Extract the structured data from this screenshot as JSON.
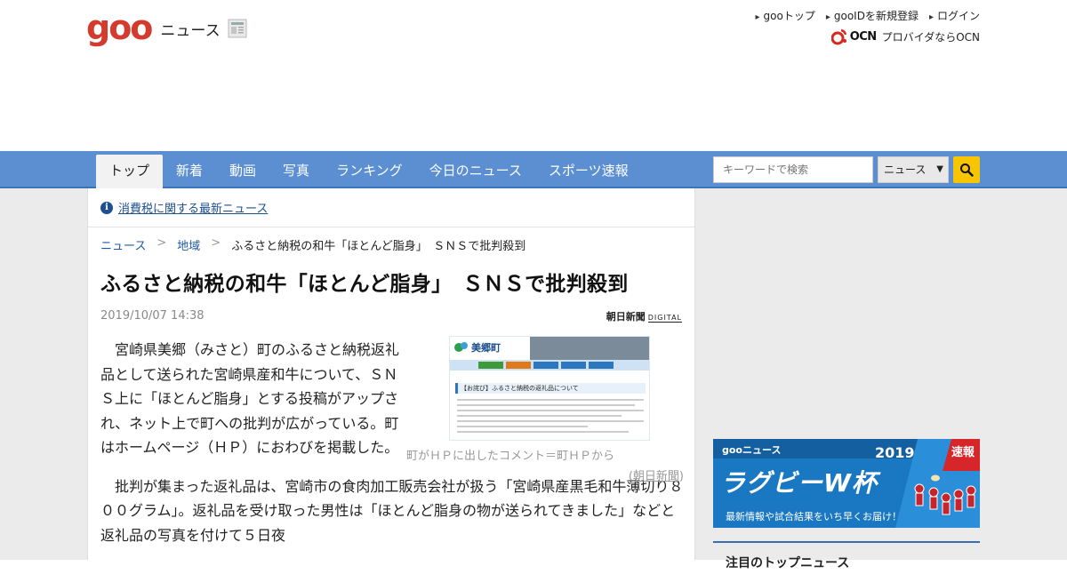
{
  "header": {
    "logo_text": "goo",
    "logo_subtitle": "ニュース",
    "links": [
      "gooトップ",
      "gooIDを新規登録",
      "ログイン"
    ],
    "ocn_label": "プロバイダならOCN",
    "ocn_logo": "OCN"
  },
  "nav": {
    "tabs": [
      "トップ",
      "新着",
      "動画",
      "写真",
      "ランキング",
      "今日のニュース",
      "スポーツ速報"
    ],
    "active_tab": "トップ",
    "search_placeholder": "キーワードで検索",
    "search_scope": "ニュース"
  },
  "notice": {
    "text": "消費税に関する最新ニュース"
  },
  "breadcrumb": {
    "items": [
      "ニュース",
      "地域",
      "ふるさと納税の和牛「ほとんど脂身」　ＳＮＳで批判殺到"
    ]
  },
  "article": {
    "title": "ふるさと納税の和牛「ほとんど脂身」　ＳＮＳで批判殺到",
    "date": "2019/10/07 14:38",
    "source_logo": "朝日新聞",
    "source_logo_suffix": "DIGITAL",
    "paragraphs": [
      "　宮崎県美郷（みさと）町のふるさと納税返礼品として送られた宮崎県産和牛について、ＳＮＳ上に「ほとんど脂身」とする投稿がアップされ、ネット上で町への批判が広がっている。町はホームページ（ＨＰ）におわびを掲載した。",
      "　批判が集まった返礼品は、宮崎市の食肉加工販売会社が扱う「宮崎県産黒毛和牛薄切り８００グラム」。返礼品を受け取った男性は「ほとんど脂身の物が送られてきました」などと返礼品の写真を付けて５日夜"
    ],
    "photo": {
      "caption": "町がＨＰに出したコメント＝町ＨＰから",
      "credit": "朝日新聞",
      "site_name": "美郷町",
      "headline": "【お詫び】ふるさと納税の返礼品について"
    }
  },
  "sidebar": {
    "banner_brand": "gooニュース",
    "banner_year": "2019",
    "banner_flash": "速報",
    "banner_title": "ラグビーW杯",
    "banner_sub": "最新情報や試合結果をいち早くお届け！",
    "section_title": "注目のトップニュース"
  }
}
